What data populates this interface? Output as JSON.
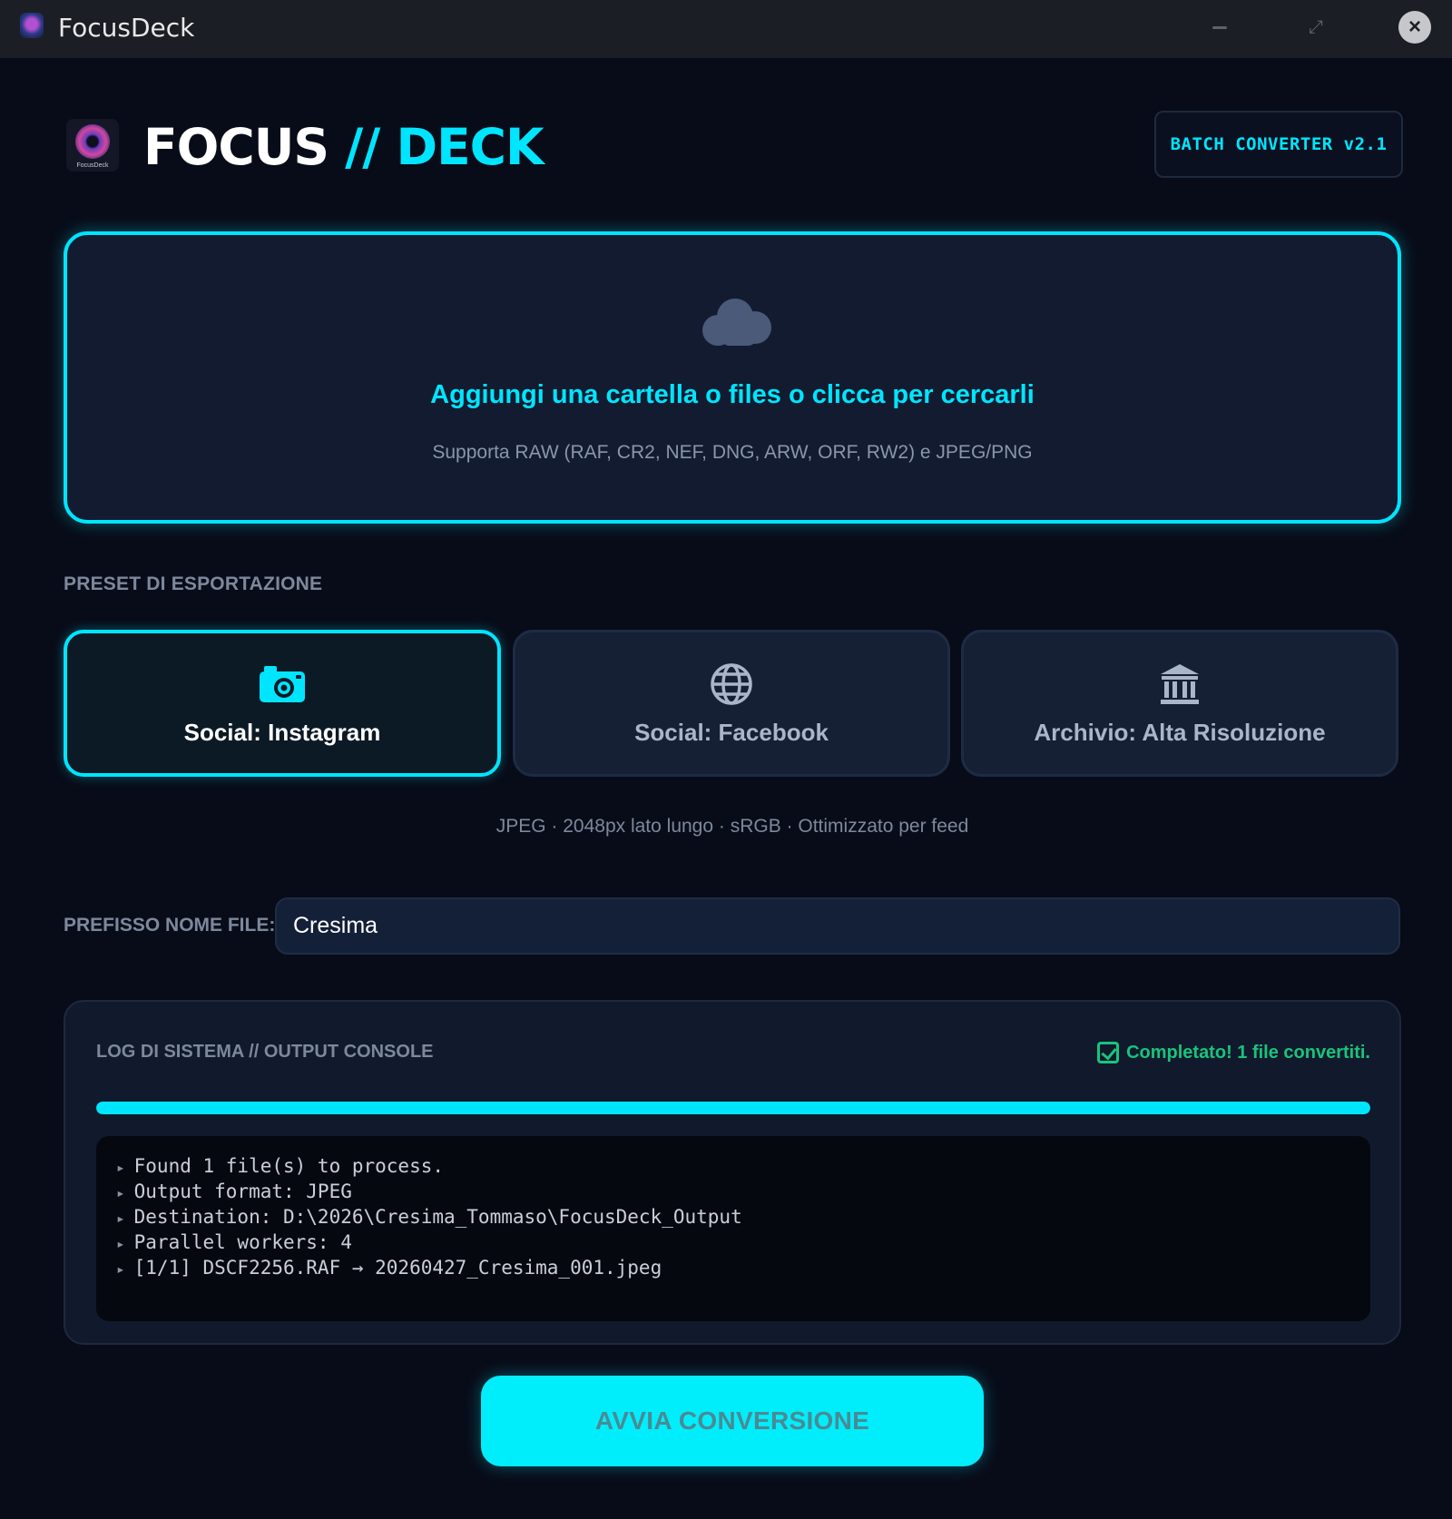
{
  "window": {
    "title": "FocusDeck"
  },
  "header": {
    "logo_caption": "FocusDeck",
    "brand_word1": "FOCUS",
    "brand_sep": " // ",
    "brand_word2": "DECK",
    "version_badge": "BATCH CONVERTER v2.1"
  },
  "dropzone": {
    "icon": "cloud-upload-icon",
    "title": "Aggiungi una cartella o files o clicca per cercarli",
    "subtitle": "Supporta RAW (RAF, CR2, NEF, DNG, ARW, ORF, RW2) e JPEG/PNG"
  },
  "presets": {
    "section_label": "PRESET DI ESPORTAZIONE",
    "items": [
      {
        "label": "Social: Instagram",
        "icon": "camera-icon",
        "active": true
      },
      {
        "label": "Social: Facebook",
        "icon": "globe-icon",
        "active": false
      },
      {
        "label": "Archivio: Alta Risoluzione",
        "icon": "bank-icon",
        "active": false
      }
    ],
    "description": "JPEG · 2048px lato lungo · sRGB · Ottimizzato per feed"
  },
  "prefix": {
    "label": "PREFISSO NOME FILE:",
    "value": "Cresima"
  },
  "log": {
    "title": "LOG DI SISTEMA // OUTPUT CONSOLE",
    "status": "Completato! 1 file convertiti.",
    "progress": 1.0,
    "lines": [
      "Found 1 file(s) to process.",
      "Output format: JPEG",
      "Destination: D:\\2026\\Cresima_Tommaso\\FocusDeck_Output",
      "Parallel workers: 4",
      "[1/1] DSCF2256.RAF → 20260427_Cresima_001.jpeg"
    ]
  },
  "actions": {
    "start_label": "AVVIA CONVERSIONE"
  },
  "colors": {
    "accent": "#00e5ff",
    "success": "#19c37d",
    "background": "#080c18"
  }
}
